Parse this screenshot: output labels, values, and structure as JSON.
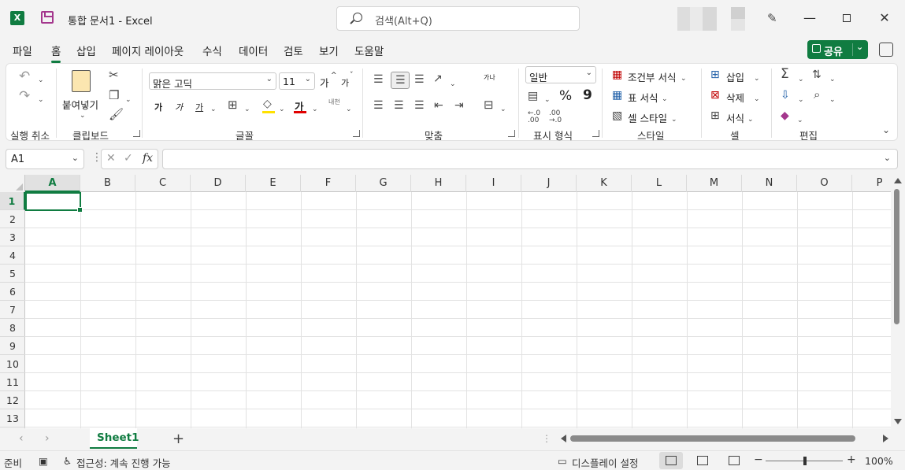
{
  "window": {
    "title": "통합 문서1  -  Excel",
    "app_icon": "excel-logo"
  },
  "search": {
    "placeholder": "검색(Alt+Q)"
  },
  "tabs": [
    "파일",
    "홈",
    "삽입",
    "페이지 레이아웃",
    "수식",
    "데이터",
    "검토",
    "보기",
    "도움말"
  ],
  "active_tab": "홈",
  "share": {
    "label": "공유"
  },
  "ribbon": {
    "groups": {
      "undo": "실행 취소",
      "clipboard": "클립보드",
      "font": "글꼴",
      "alignment": "맞춤",
      "number": "표시 형식",
      "styles": "스타일",
      "cells": "셀",
      "editing": "편집"
    },
    "paste_label": "붙여넣기",
    "font_name": "맑은 고딕",
    "font_size": "11",
    "grow_font": "가",
    "shrink_font": "가",
    "bold": "가",
    "italic": "가",
    "underline": "가",
    "font_color_glyph": "가",
    "phonetic": "내천",
    "wrap_text": "가나",
    "number_format": "일반",
    "percent": "%",
    "comma": "9",
    "conditional_format": "조건부 서식",
    "format_as_table": "표 서식",
    "cell_styles": "셀 스타일",
    "insert": "삽입",
    "delete": "삭제",
    "format": "서식",
    "fill_color": "#ffe100",
    "font_color": "#e10000"
  },
  "formula_bar": {
    "name_box": "A1",
    "fx": "fx",
    "value": ""
  },
  "grid": {
    "columns": [
      "A",
      "B",
      "C",
      "D",
      "E",
      "F",
      "G",
      "H",
      "I",
      "J",
      "K",
      "L",
      "M",
      "N",
      "O",
      "P"
    ],
    "rows": [
      "1",
      "2",
      "3",
      "4",
      "5",
      "6",
      "7",
      "8",
      "9",
      "10",
      "11",
      "12",
      "13"
    ],
    "selected_cell": "A1"
  },
  "sheets": [
    "Sheet1"
  ],
  "status": {
    "ready": "준비",
    "accessibility": "접근성: 계속 진행 가능",
    "display_settings": "디스플레이 설정",
    "zoom": "100%"
  },
  "colors": {
    "accent": "#107c41"
  }
}
